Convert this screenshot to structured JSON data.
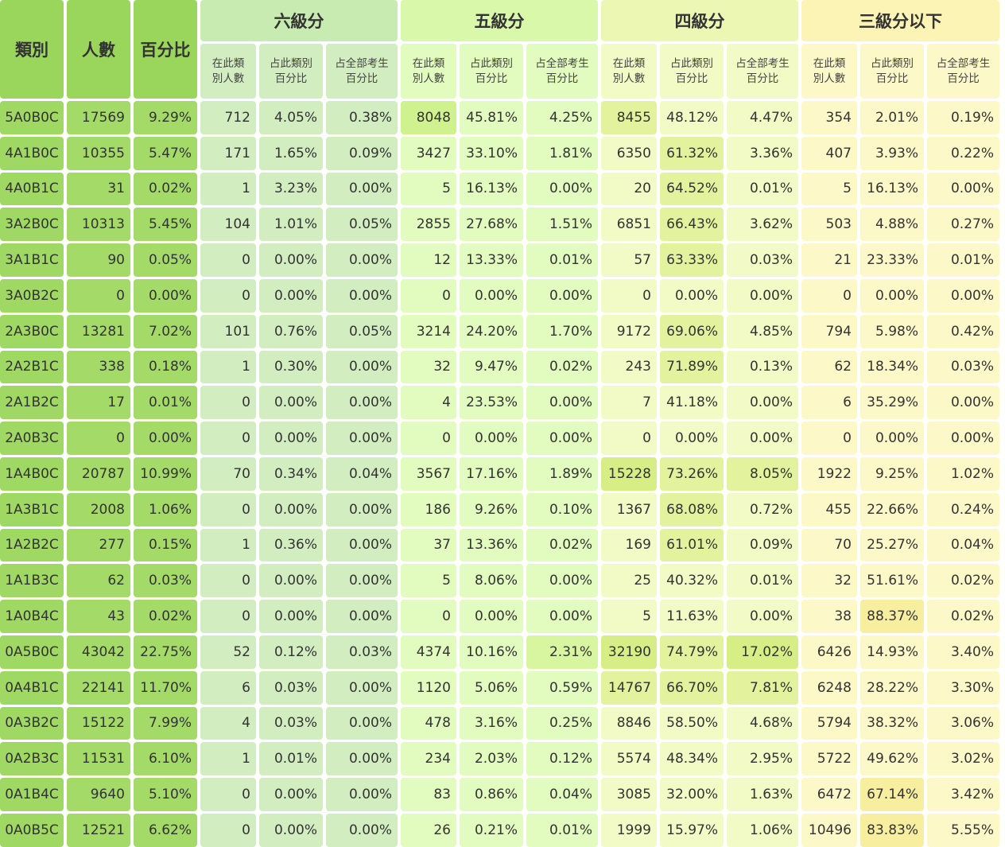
{
  "headers": {
    "category": "類別",
    "count": "人數",
    "percent": "百分比",
    "groups": [
      "六級分",
      "五級分",
      "四級分",
      "三級分以下"
    ],
    "sub": {
      "in_cat_count": [
        "在此類",
        "別人數"
      ],
      "pct_of_cat": [
        "占此類別",
        "百分比"
      ],
      "pct_of_all": [
        "占全部考生",
        "百分比"
      ]
    }
  },
  "rows": [
    {
      "cat": "5A0B0C",
      "n": "17569",
      "p": "9.29%",
      "g6": [
        "712",
        "4.05%",
        "0.38%"
      ],
      "g5": [
        "8048",
        "45.81%",
        "4.25%"
      ],
      "g4": [
        "8455",
        "48.12%",
        "4.47%"
      ],
      "g3": [
        "354",
        "2.01%",
        "0.19%"
      ]
    },
    {
      "cat": "4A1B0C",
      "n": "10355",
      "p": "5.47%",
      "g6": [
        "171",
        "1.65%",
        "0.09%"
      ],
      "g5": [
        "3427",
        "33.10%",
        "1.81%"
      ],
      "g4": [
        "6350",
        "61.32%",
        "3.36%"
      ],
      "g3": [
        "407",
        "3.93%",
        "0.22%"
      ]
    },
    {
      "cat": "4A0B1C",
      "n": "31",
      "p": "0.02%",
      "g6": [
        "1",
        "3.23%",
        "0.00%"
      ],
      "g5": [
        "5",
        "16.13%",
        "0.00%"
      ],
      "g4": [
        "20",
        "64.52%",
        "0.01%"
      ],
      "g3": [
        "5",
        "16.13%",
        "0.00%"
      ]
    },
    {
      "cat": "3A2B0C",
      "n": "10313",
      "p": "5.45%",
      "g6": [
        "104",
        "1.01%",
        "0.05%"
      ],
      "g5": [
        "2855",
        "27.68%",
        "1.51%"
      ],
      "g4": [
        "6851",
        "66.43%",
        "3.62%"
      ],
      "g3": [
        "503",
        "4.88%",
        "0.27%"
      ]
    },
    {
      "cat": "3A1B1C",
      "n": "90",
      "p": "0.05%",
      "g6": [
        "0",
        "0.00%",
        "0.00%"
      ],
      "g5": [
        "12",
        "13.33%",
        "0.01%"
      ],
      "g4": [
        "57",
        "63.33%",
        "0.03%"
      ],
      "g3": [
        "21",
        "23.33%",
        "0.01%"
      ]
    },
    {
      "cat": "3A0B2C",
      "n": "0",
      "p": "0.00%",
      "g6": [
        "0",
        "0.00%",
        "0.00%"
      ],
      "g5": [
        "0",
        "0.00%",
        "0.00%"
      ],
      "g4": [
        "0",
        "0.00%",
        "0.00%"
      ],
      "g3": [
        "0",
        "0.00%",
        "0.00%"
      ]
    },
    {
      "cat": "2A3B0C",
      "n": "13281",
      "p": "7.02%",
      "g6": [
        "101",
        "0.76%",
        "0.05%"
      ],
      "g5": [
        "3214",
        "24.20%",
        "1.70%"
      ],
      "g4": [
        "9172",
        "69.06%",
        "4.85%"
      ],
      "g3": [
        "794",
        "5.98%",
        "0.42%"
      ]
    },
    {
      "cat": "2A2B1C",
      "n": "338",
      "p": "0.18%",
      "g6": [
        "1",
        "0.30%",
        "0.00%"
      ],
      "g5": [
        "32",
        "9.47%",
        "0.02%"
      ],
      "g4": [
        "243",
        "71.89%",
        "0.13%"
      ],
      "g3": [
        "62",
        "18.34%",
        "0.03%"
      ]
    },
    {
      "cat": "2A1B2C",
      "n": "17",
      "p": "0.01%",
      "g6": [
        "0",
        "0.00%",
        "0.00%"
      ],
      "g5": [
        "4",
        "23.53%",
        "0.00%"
      ],
      "g4": [
        "7",
        "41.18%",
        "0.00%"
      ],
      "g3": [
        "6",
        "35.29%",
        "0.00%"
      ]
    },
    {
      "cat": "2A0B3C",
      "n": "0",
      "p": "0.00%",
      "g6": [
        "0",
        "0.00%",
        "0.00%"
      ],
      "g5": [
        "0",
        "0.00%",
        "0.00%"
      ],
      "g4": [
        "0",
        "0.00%",
        "0.00%"
      ],
      "g3": [
        "0",
        "0.00%",
        "0.00%"
      ]
    },
    {
      "cat": "1A4B0C",
      "n": "20787",
      "p": "10.99%",
      "g6": [
        "70",
        "0.34%",
        "0.04%"
      ],
      "g5": [
        "3567",
        "17.16%",
        "1.89%"
      ],
      "g4": [
        "15228",
        "73.26%",
        "8.05%"
      ],
      "g3": [
        "1922",
        "9.25%",
        "1.02%"
      ]
    },
    {
      "cat": "1A3B1C",
      "n": "2008",
      "p": "1.06%",
      "g6": [
        "0",
        "0.00%",
        "0.00%"
      ],
      "g5": [
        "186",
        "9.26%",
        "0.10%"
      ],
      "g4": [
        "1367",
        "68.08%",
        "0.72%"
      ],
      "g3": [
        "455",
        "22.66%",
        "0.24%"
      ]
    },
    {
      "cat": "1A2B2C",
      "n": "277",
      "p": "0.15%",
      "g6": [
        "1",
        "0.36%",
        "0.00%"
      ],
      "g5": [
        "37",
        "13.36%",
        "0.02%"
      ],
      "g4": [
        "169",
        "61.01%",
        "0.09%"
      ],
      "g3": [
        "70",
        "25.27%",
        "0.04%"
      ]
    },
    {
      "cat": "1A1B3C",
      "n": "62",
      "p": "0.03%",
      "g6": [
        "0",
        "0.00%",
        "0.00%"
      ],
      "g5": [
        "5",
        "8.06%",
        "0.00%"
      ],
      "g4": [
        "25",
        "40.32%",
        "0.01%"
      ],
      "g3": [
        "32",
        "51.61%",
        "0.02%"
      ]
    },
    {
      "cat": "1A0B4C",
      "n": "43",
      "p": "0.02%",
      "g6": [
        "0",
        "0.00%",
        "0.00%"
      ],
      "g5": [
        "0",
        "0.00%",
        "0.00%"
      ],
      "g4": [
        "5",
        "11.63%",
        "0.00%"
      ],
      "g3": [
        "38",
        "88.37%",
        "0.02%"
      ]
    },
    {
      "cat": "0A5B0C",
      "n": "43042",
      "p": "22.75%",
      "g6": [
        "52",
        "0.12%",
        "0.03%"
      ],
      "g5": [
        "4374",
        "10.16%",
        "2.31%"
      ],
      "g4": [
        "32190",
        "74.79%",
        "17.02%"
      ],
      "g3": [
        "6426",
        "14.93%",
        "3.40%"
      ]
    },
    {
      "cat": "0A4B1C",
      "n": "22141",
      "p": "11.70%",
      "g6": [
        "6",
        "0.03%",
        "0.00%"
      ],
      "g5": [
        "1120",
        "5.06%",
        "0.59%"
      ],
      "g4": [
        "14767",
        "66.70%",
        "7.81%"
      ],
      "g3": [
        "6248",
        "28.22%",
        "3.30%"
      ]
    },
    {
      "cat": "0A3B2C",
      "n": "15122",
      "p": "7.99%",
      "g6": [
        "4",
        "0.03%",
        "0.00%"
      ],
      "g5": [
        "478",
        "3.16%",
        "0.25%"
      ],
      "g4": [
        "8846",
        "58.50%",
        "4.68%"
      ],
      "g3": [
        "5794",
        "38.32%",
        "3.06%"
      ]
    },
    {
      "cat": "0A2B3C",
      "n": "11531",
      "p": "6.10%",
      "g6": [
        "1",
        "0.01%",
        "0.00%"
      ],
      "g5": [
        "234",
        "2.03%",
        "0.12%"
      ],
      "g4": [
        "5574",
        "48.34%",
        "2.95%"
      ],
      "g3": [
        "5722",
        "49.62%",
        "3.02%"
      ]
    },
    {
      "cat": "0A1B4C",
      "n": "9640",
      "p": "5.10%",
      "g6": [
        "0",
        "0.00%",
        "0.00%"
      ],
      "g5": [
        "83",
        "0.86%",
        "0.04%"
      ],
      "g4": [
        "3085",
        "32.00%",
        "1.63%"
      ],
      "g3": [
        "6472",
        "67.14%",
        "3.42%"
      ]
    },
    {
      "cat": "0A0B5C",
      "n": "12521",
      "p": "6.62%",
      "g6": [
        "0",
        "0.00%",
        "0.00%"
      ],
      "g5": [
        "26",
        "0.21%",
        "0.01%"
      ],
      "g4": [
        "1999",
        "15.97%",
        "1.06%"
      ],
      "g3": [
        "10496",
        "83.83%",
        "5.55%"
      ]
    }
  ],
  "colors": {
    "header_green": "#9bd65c",
    "base_col": "#a4da68",
    "six": "#d2eec0",
    "five": "#e2fbbe",
    "four": "#f2fac6",
    "three": "#fdf8c8"
  }
}
